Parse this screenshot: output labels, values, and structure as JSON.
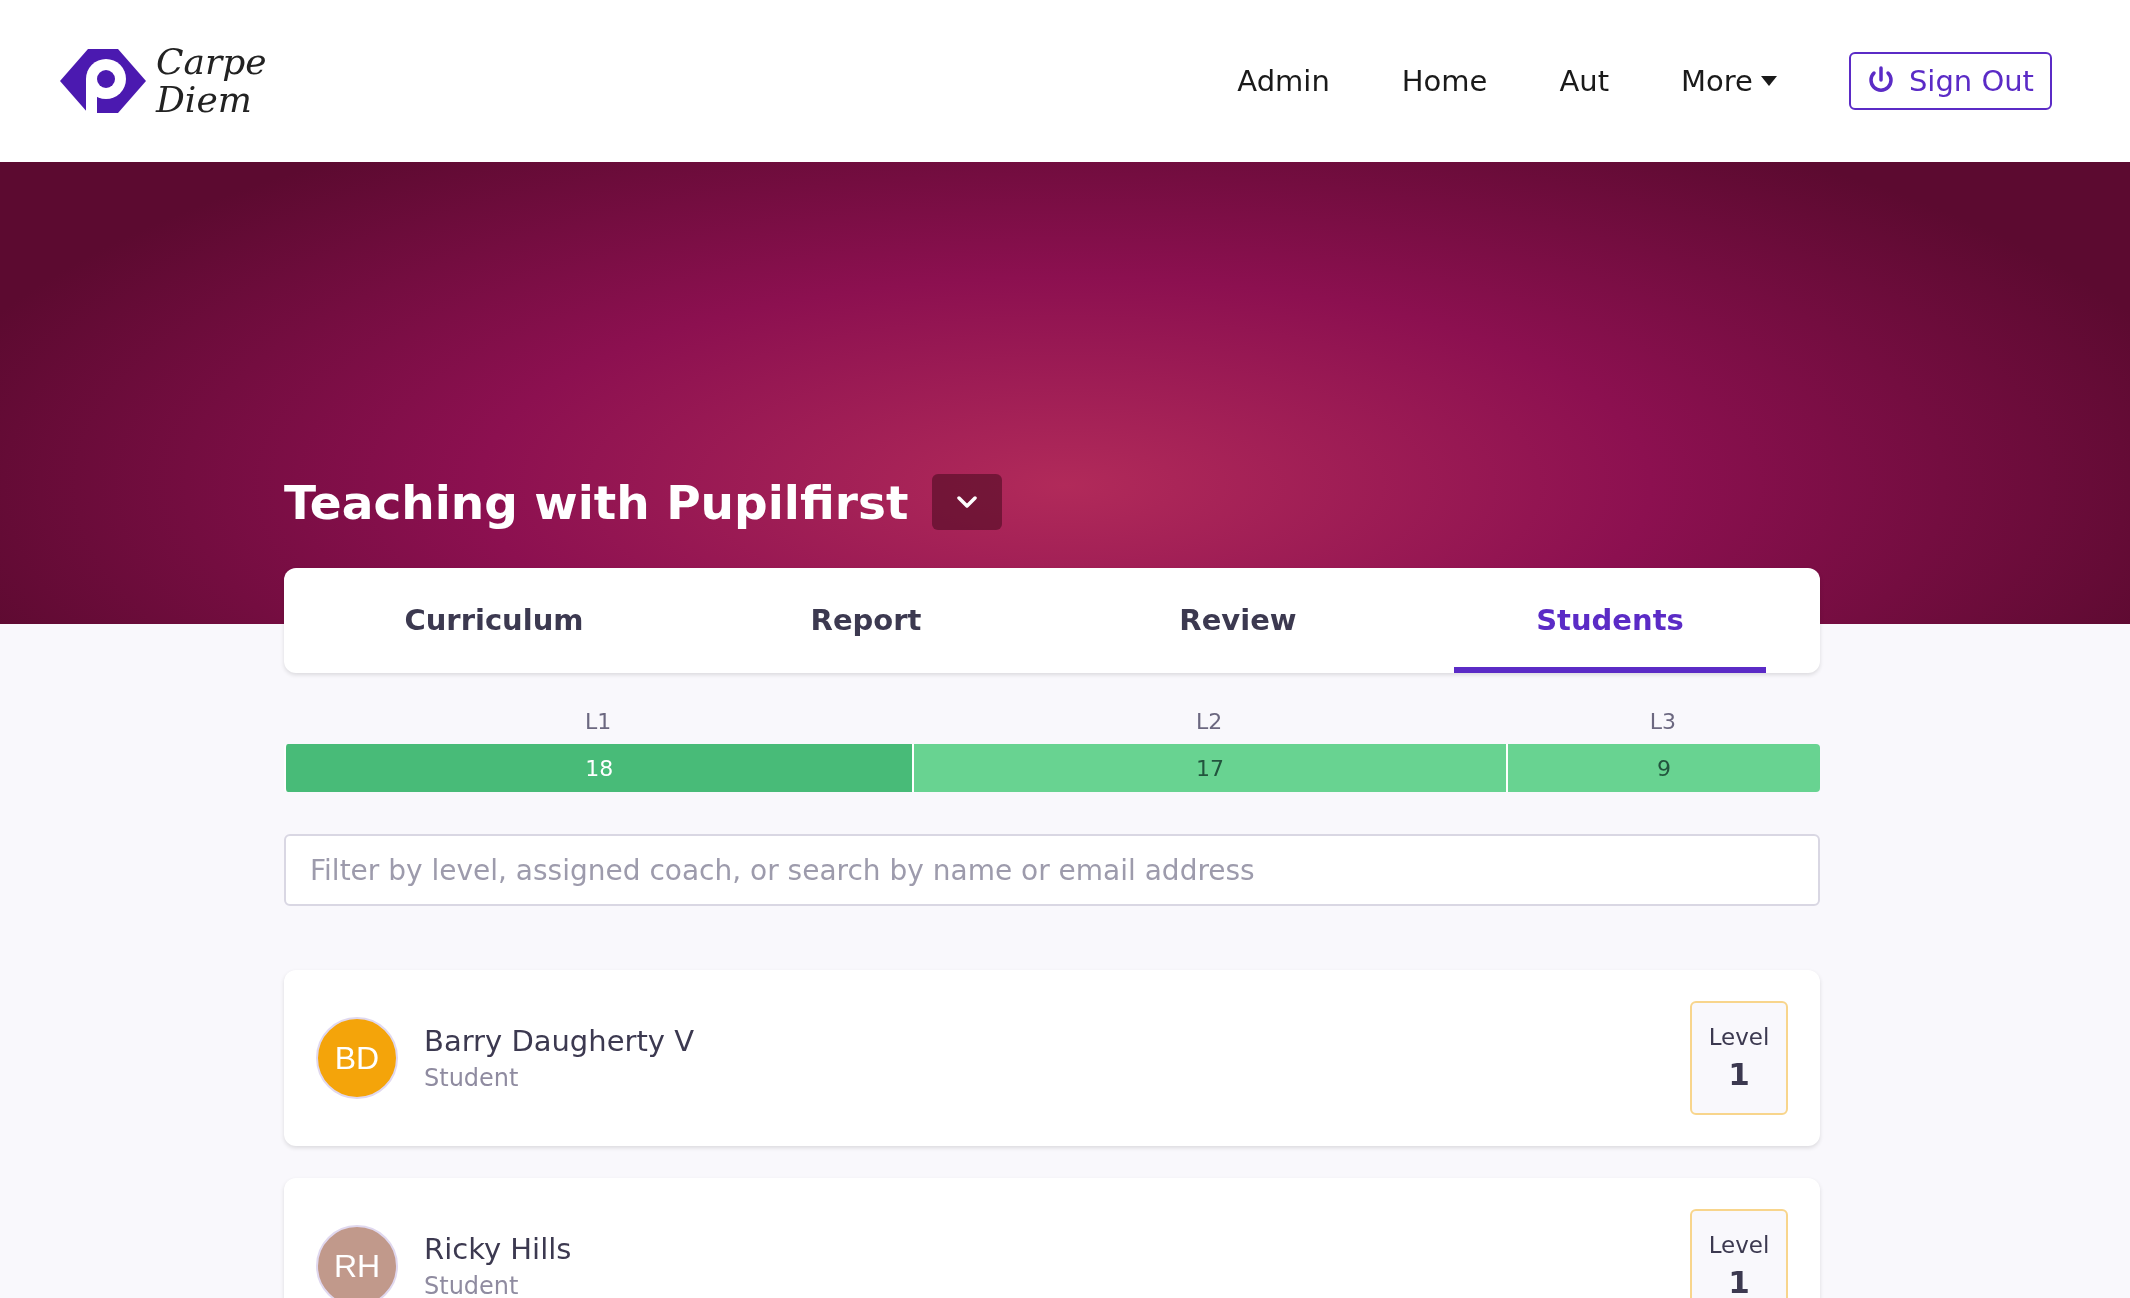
{
  "header": {
    "logo": {
      "line_1": "Carpe",
      "line_2": "Diem"
    },
    "nav": [
      {
        "label": "Admin",
        "kind": "link"
      },
      {
        "label": "Home",
        "kind": "link"
      },
      {
        "label": "Aut",
        "kind": "link"
      },
      {
        "label": "More",
        "kind": "dropdown"
      }
    ],
    "sign_out": {
      "label": "Sign Out"
    }
  },
  "course": {
    "title": "Teaching with Pupilfirst"
  },
  "tabs": [
    {
      "label": "Curriculum",
      "selected": false
    },
    {
      "label": "Report",
      "selected": false
    },
    {
      "label": "Review",
      "selected": false
    },
    {
      "label": "Students",
      "selected": true
    }
  ],
  "level_distribution": [
    {
      "label": "L1",
      "count": "18",
      "color": "#48bb78"
    },
    {
      "label": "L2",
      "count": "17",
      "color": "#68d391"
    },
    {
      "label": "L3",
      "count": "9",
      "color": "#68d391"
    }
  ],
  "filter": {
    "placeholder": "Filter by level, assigned coach, or search by name or email address"
  },
  "students": [
    {
      "initials": "BD",
      "name": "Barry Daugherty V",
      "role": "Student",
      "level_label": "Level",
      "level_number": "1",
      "color": "#f4a40a"
    },
    {
      "initials": "RH",
      "name": "Ricky Hills",
      "role": "Student",
      "level_label": "Level",
      "level_number": "1",
      "color": "#c1998b"
    }
  ]
}
